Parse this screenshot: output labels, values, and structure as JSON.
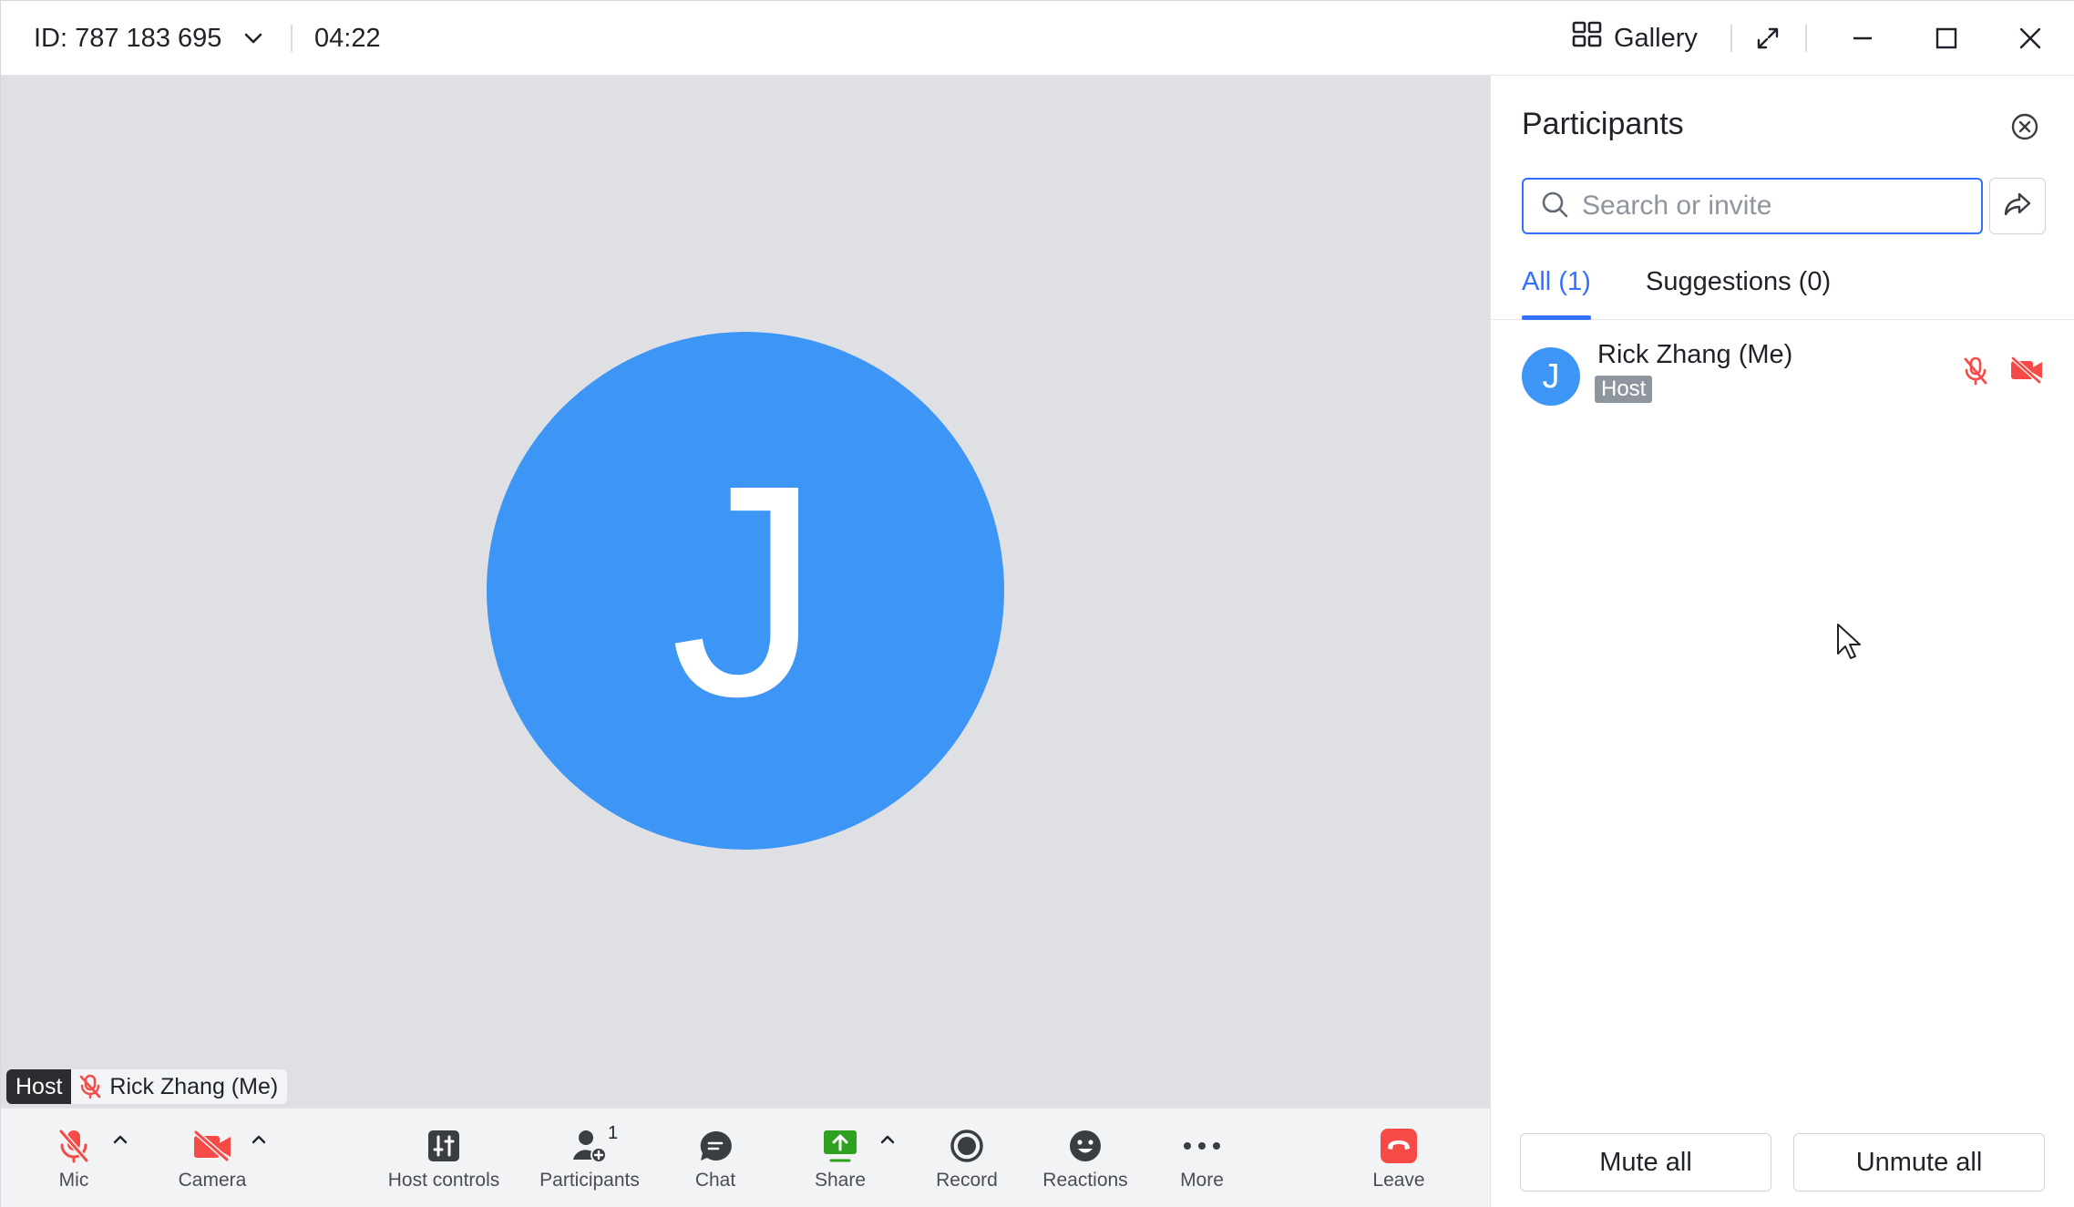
{
  "titlebar": {
    "meeting_id": "ID: 787 183 695",
    "timer": "04:22",
    "gallery_label": "Gallery"
  },
  "stage": {
    "avatar_letter": "J",
    "name_tag": {
      "role": "Host",
      "name": "Rick Zhang (Me)"
    }
  },
  "toolbar": {
    "mic": "Mic",
    "camera": "Camera",
    "host_controls": "Host controls",
    "participants": "Participants",
    "participants_count": "1",
    "chat": "Chat",
    "share": "Share",
    "record": "Record",
    "reactions": "Reactions",
    "more": "More",
    "leave": "Leave"
  },
  "panel": {
    "title": "Participants",
    "search_placeholder": "Search or invite",
    "tabs": [
      {
        "label": "All (1)",
        "active": true
      },
      {
        "label": "Suggestions (0)",
        "active": false
      }
    ],
    "participants": [
      {
        "avatar_letter": "J",
        "name": "Rick Zhang (Me)",
        "role": "Host",
        "mic": "muted",
        "camera": "off"
      }
    ],
    "mute_all": "Mute all",
    "unmute_all": "Unmute all"
  },
  "colors": {
    "accent": "#3370ff",
    "avatar": "#3d95f5",
    "danger": "#f54a45",
    "share_green": "#2ea121",
    "stage_bg": "#dfe0e4"
  },
  "icons": [
    "chevron-down-icon",
    "grid-icon",
    "expand-icon",
    "minimize-icon",
    "maximize-icon",
    "close-icon",
    "mic-off-icon",
    "camera-off-icon",
    "host-controls-icon",
    "participants-icon",
    "chat-icon",
    "share-icon",
    "record-icon",
    "reactions-icon",
    "more-icon",
    "leave-icon",
    "search-icon",
    "share-arrow-icon"
  ]
}
